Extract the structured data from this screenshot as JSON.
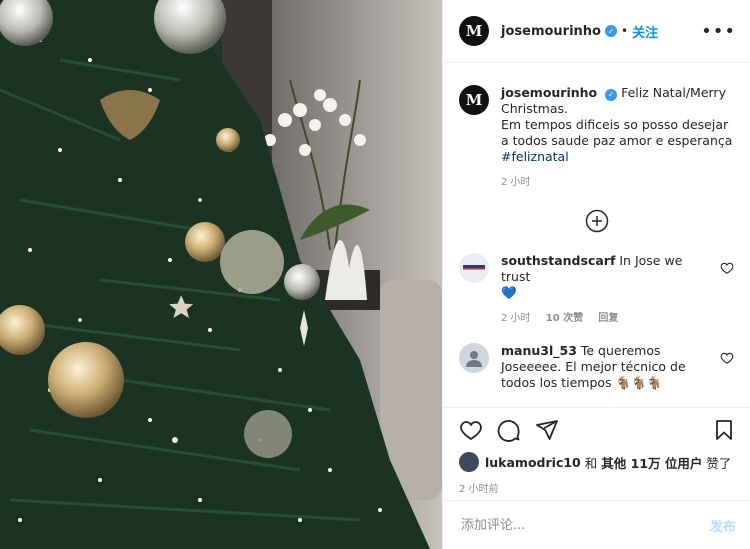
{
  "post": {
    "username": "josemourinho",
    "follow_label": "关注",
    "more_label": "•••",
    "avatar_letter": "M"
  },
  "caption": {
    "username": "josemourinho",
    "text_line1": "Feliz Natal/Merry Christmas.",
    "text_line2": "Em tempos dificeis so posso desejar a todos saude paz amor e esperança",
    "hashtag": "#feliznatal",
    "time": "2 小时"
  },
  "comments": [
    {
      "username": "southstandscarf",
      "text": "In Jose we trust",
      "extra": "💙",
      "time": "2 小时",
      "likes": "10 次赞",
      "reply": "回复"
    },
    {
      "username": "manu3l_53",
      "text": "Te queremos Joseeeee. El mejor técnico de todos los tiempos 🐐🐐🐐",
      "time": "",
      "likes": "",
      "reply": ""
    }
  ],
  "likes_row": {
    "liker": "lukamodric10",
    "and": "和",
    "others": "其他 11万 位用户",
    "suffix": "赞了"
  },
  "post_time": "2 小时前",
  "add_comment": {
    "placeholder": "添加评论...",
    "post_label": "发布"
  },
  "colors": {
    "accent": "#0095f6",
    "verified": "#3897f0",
    "hashtag": "#00376b",
    "muted": "#8e8e8e",
    "post_disabled": "#b2dffc"
  },
  "icons": [
    "verified-badge-icon",
    "more-icon",
    "add-comments-icon",
    "heart-icon",
    "comment-icon",
    "share-icon",
    "bookmark-icon"
  ]
}
